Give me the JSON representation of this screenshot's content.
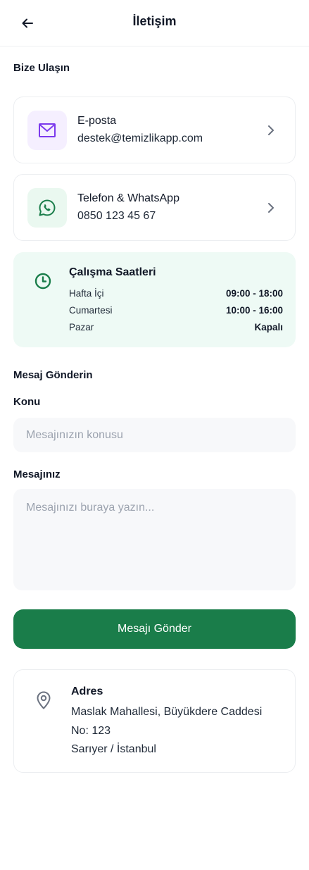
{
  "header": {
    "title": "İletişim",
    "back_icon": "arrow-left-icon"
  },
  "contact_section": {
    "title": "Bize Ulaşın"
  },
  "contacts": [
    {
      "label": "E-posta",
      "value": "destek@temizlikapp.com",
      "icon": "mail-icon",
      "icon_color": "#7c3aed",
      "icon_bg": "#f5efff"
    },
    {
      "label": "Telefon & WhatsApp",
      "value": "0850 123 45 67",
      "icon": "whatsapp-icon",
      "icon_color": "#1a7d4a",
      "icon_bg": "#eaf8f0"
    }
  ],
  "hours": {
    "title": "Çalışma Saatleri",
    "icon": "clock-icon",
    "rows": [
      {
        "day": "Hafta İçi",
        "time": "09:00 - 18:00"
      },
      {
        "day": "Cumartesi",
        "time": "10:00 - 16:00"
      },
      {
        "day": "Pazar",
        "time": "Kapalı"
      }
    ]
  },
  "message_section": {
    "title": "Mesaj Gönderin",
    "subject_label": "Konu",
    "subject_placeholder": "Mesajınızın konusu",
    "message_label": "Mesajınız",
    "message_placeholder": "Mesajınızı buraya yazın...",
    "send_label": "Mesajı Gönder"
  },
  "address": {
    "title": "Adres",
    "icon": "map-pin-icon",
    "lines": [
      "Maslak Mahallesi, Büyükdere Caddesi",
      "No: 123",
      "Sarıyer / İstanbul"
    ]
  },
  "colors": {
    "primary": "#1a7d4a",
    "hours_bg": "#eefaf5",
    "input_bg": "#f7f8fa"
  }
}
